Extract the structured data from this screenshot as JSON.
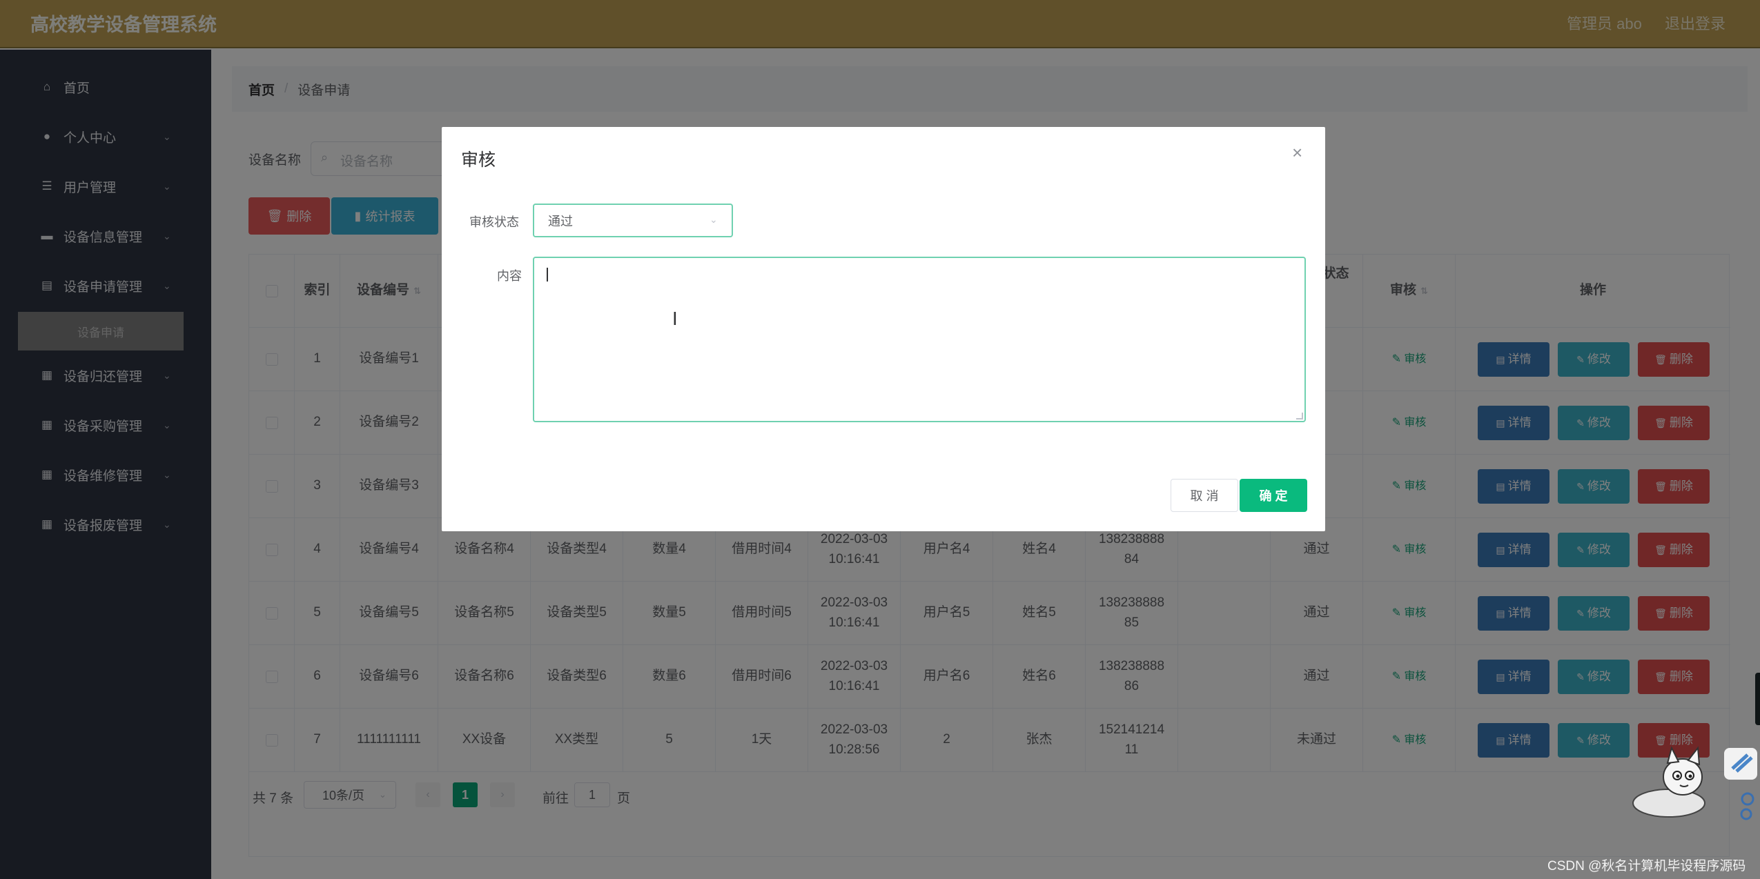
{
  "app": {
    "title": "高校教学设备管理系统",
    "user": "管理员 abo",
    "logout": "退出登录"
  },
  "sidebar": {
    "items": [
      {
        "label": "首页",
        "icon": "home-icon",
        "glyph": "⌂",
        "expandable": false
      },
      {
        "label": "个人中心",
        "icon": "user-icon",
        "glyph": "●",
        "expandable": true
      },
      {
        "label": "用户管理",
        "icon": "list-icon",
        "glyph": "☰",
        "expandable": true
      },
      {
        "label": "设备信息管理",
        "icon": "monitor-icon",
        "glyph": "▬",
        "expandable": true
      },
      {
        "label": "设备申请管理",
        "icon": "clipboard-icon",
        "glyph": "▤",
        "expandable": true
      },
      {
        "label": "设备归还管理",
        "icon": "grid-icon",
        "glyph": "▦",
        "expandable": true
      },
      {
        "label": "设备采购管理",
        "icon": "grid-icon",
        "glyph": "▦",
        "expandable": true
      },
      {
        "label": "设备维修管理",
        "icon": "grid-icon",
        "glyph": "▦",
        "expandable": true
      },
      {
        "label": "设备报废管理",
        "icon": "apps-icon",
        "glyph": "▦",
        "expandable": true
      }
    ],
    "active_sub": "设备申请"
  },
  "breadcrumb": {
    "home": "首页",
    "separator": "/",
    "current": "设备申请"
  },
  "search": {
    "label": "设备名称",
    "placeholder": "设备名称"
  },
  "toolbar": {
    "delete_label": "删除",
    "stats_label": "统计报表"
  },
  "table": {
    "headers": {
      "index": "索引",
      "code": "设备编号",
      "status_partial": "状态",
      "audit": "审核",
      "ops": "操作"
    },
    "rows": [
      {
        "index": "1",
        "code": "设备编号1"
      },
      {
        "index": "2",
        "code": "设备编号2"
      },
      {
        "index": "3",
        "code": "设备编号3"
      },
      {
        "index": "4",
        "code": "设备编号4",
        "name": "设备名称4",
        "type": "设备类型4",
        "qty": "数量4",
        "borrow": "借用时间4",
        "date": "2022-03-03",
        "time": "10:16:41",
        "user": "用户名4",
        "realname": "姓名4",
        "phone_a": "138238888",
        "phone_b": "84",
        "status": "通过"
      },
      {
        "index": "5",
        "code": "设备编号5",
        "name": "设备名称5",
        "type": "设备类型5",
        "qty": "数量5",
        "borrow": "借用时间5",
        "date": "2022-03-03",
        "time": "10:16:41",
        "user": "用户名5",
        "realname": "姓名5",
        "phone_a": "138238888",
        "phone_b": "85",
        "status": "通过"
      },
      {
        "index": "6",
        "code": "设备编号6",
        "name": "设备名称6",
        "type": "设备类型6",
        "qty": "数量6",
        "borrow": "借用时间6",
        "date": "2022-03-03",
        "time": "10:16:41",
        "user": "用户名6",
        "realname": "姓名6",
        "phone_a": "138238888",
        "phone_b": "86",
        "status": "通过"
      },
      {
        "index": "7",
        "code": "1111111111",
        "name": "XX设备",
        "type": "XX类型",
        "qty": "5",
        "borrow": "1天",
        "date": "2022-03-03",
        "time": "10:28:56",
        "user": "2",
        "realname": "张杰",
        "phone_a": "152141214",
        "phone_b": "11",
        "status": "未通过"
      }
    ],
    "audit_link": "审核",
    "op_detail": "详情",
    "op_edit": "修改",
    "op_delete": "删除"
  },
  "pagination": {
    "total": "共 7 条",
    "page_size": "10条/页",
    "prev": "‹",
    "current": "1",
    "next": "›",
    "goto_prefix": "前往",
    "goto_value": "1",
    "goto_suffix": "页"
  },
  "dialog": {
    "title": "审核",
    "close": "×",
    "status_label": "审核状态",
    "status_value": "通过",
    "content_label": "内容",
    "content_value": "",
    "cancel": "取 消",
    "confirm": "确 定"
  },
  "watermark": "CSDN @秋名计算机毕设程序源码",
  "colors": {
    "header": "#c0a155",
    "sidebar": "#2e3442",
    "primary": "#0aba7e",
    "danger": "#e04f4f",
    "info": "#3a7bb8",
    "cyan": "#3db2c8"
  }
}
